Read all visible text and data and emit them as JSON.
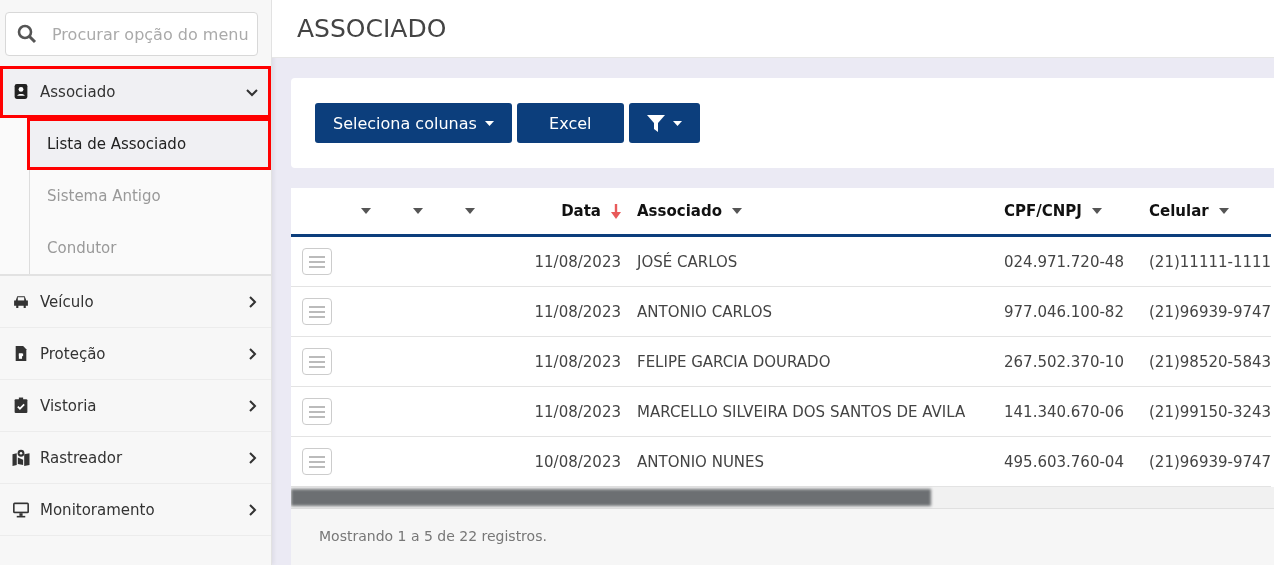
{
  "sidebar": {
    "search": {
      "placeholder": "Procurar opção do menu"
    },
    "items": [
      {
        "label": "Associado",
        "expanded": true,
        "highlighted": true,
        "children": [
          {
            "label": "Lista de Associado",
            "selected": true,
            "highlighted": true
          },
          {
            "label": "Sistema Antigo",
            "selected": false,
            "highlighted": false
          },
          {
            "label": "Condutor",
            "selected": false,
            "highlighted": false
          }
        ]
      },
      {
        "label": "Veículo",
        "expanded": false,
        "highlighted": false
      },
      {
        "label": "Proteção",
        "expanded": false,
        "highlighted": false
      },
      {
        "label": "Vistoria",
        "expanded": false,
        "highlighted": false
      },
      {
        "label": "Rastreador",
        "expanded": false,
        "highlighted": false
      },
      {
        "label": "Monitoramento",
        "expanded": false,
        "highlighted": false
      }
    ]
  },
  "page": {
    "title": "ASSOCIADO"
  },
  "toolbar": {
    "buttons": [
      {
        "kind": "dropdown",
        "label": "Seleciona colunas"
      },
      {
        "kind": "plain",
        "label": "Excel"
      },
      {
        "kind": "filter"
      }
    ]
  },
  "table": {
    "columns": [
      {
        "kind": "text",
        "sorted": false
      },
      {
        "kind": "text",
        "sorted": false
      },
      {
        "kind": "text",
        "sorted": false
      },
      {
        "label": "Data",
        "kind": "date",
        "sorted": true
      },
      {
        "label": "Associado",
        "kind": "text",
        "sorted": false
      },
      {
        "label": "CPF/CNPJ",
        "kind": "text",
        "sorted": false
      },
      {
        "label": "Celular",
        "kind": "text",
        "sorted": false
      }
    ],
    "rows": [
      [
        "",
        "",
        "",
        "11/08/2023",
        "JOSÉ CARLOS",
        "024.971.720-48",
        "(21)11111-1111"
      ],
      [
        "",
        "",
        "",
        "11/08/2023",
        "ANTONIO CARLOS",
        "977.046.100-82",
        "(21)96939-9747"
      ],
      [
        "",
        "",
        "",
        "11/08/2023",
        "FELIPE GARCIA DOURADO",
        "267.502.370-10",
        "(21)98520-5843"
      ],
      [
        "",
        "",
        "",
        "11/08/2023",
        "MARCELLO SILVEIRA DOS SANTOS DE AVILA",
        "141.340.670-06",
        "(21)99150-3243"
      ],
      [
        "",
        "",
        "",
        "10/08/2023",
        "ANTONIO NUNES",
        "495.603.760-04",
        "(21)96939-9747"
      ]
    ],
    "footer": "Mostrando 1 a 5 de 22 registros."
  }
}
